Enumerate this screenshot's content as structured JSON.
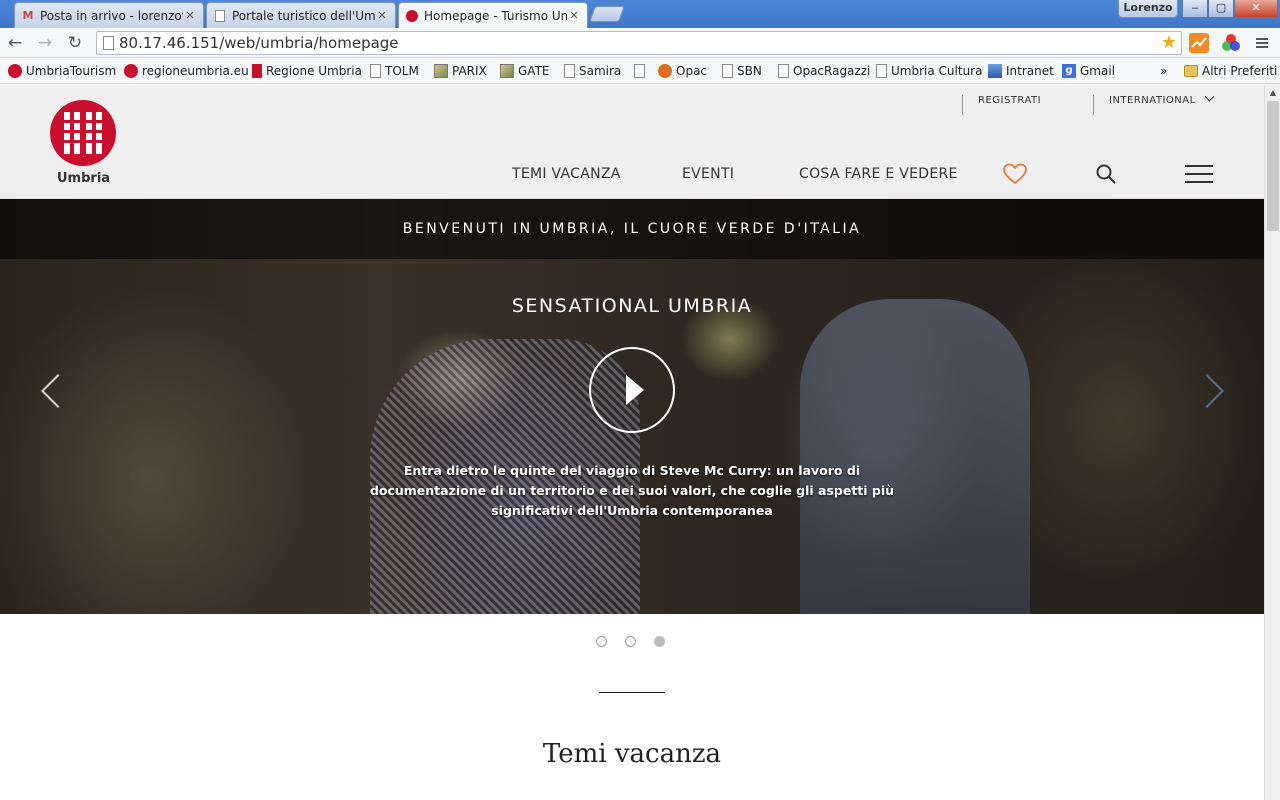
{
  "browser": {
    "tabs": [
      {
        "title": "Posta in arrivo - lorenzotra",
        "icon": "gmail-icon",
        "active": false
      },
      {
        "title": "Portale turistico dell'Umbr",
        "icon": "page-icon",
        "active": false
      },
      {
        "title": "Homepage - Turismo Um",
        "icon": "umbria-icon",
        "active": true
      }
    ],
    "close_glyph": "✕",
    "user": "Lorenzo",
    "window_buttons": {
      "minimize": "‒",
      "maximize": "▢",
      "close": "✕"
    },
    "nav": {
      "back": "←",
      "forward": "→",
      "reload": "↻"
    },
    "address": "80.17.46.151/web/umbria/homepage",
    "star": "★",
    "bookmarks": [
      {
        "label": "UmbriaTourism",
        "icon": "red"
      },
      {
        "label": "regioneumbria.eu",
        "icon": "red"
      },
      {
        "label": "Regione Umbria",
        "icon": "red"
      },
      {
        "label": "TOLM",
        "icon": "doc"
      },
      {
        "label": "PARIX",
        "icon": "img"
      },
      {
        "label": "GATE",
        "icon": "img"
      },
      {
        "label": "Samira",
        "icon": "doc"
      },
      {
        "label": "",
        "icon": "doc"
      },
      {
        "label": "Opac",
        "icon": "opac"
      },
      {
        "label": "SBN",
        "icon": "doc"
      },
      {
        "label": "OpacRagazzi",
        "icon": "doc"
      },
      {
        "label": "Umbria Cultura",
        "icon": "doc"
      },
      {
        "label": "Intranet",
        "icon": "intranet"
      },
      {
        "label": "Gmail",
        "icon": "g"
      }
    ],
    "more": "»",
    "other_bookmarks": "Altri Preferiti"
  },
  "header": {
    "logo_text": "Umbria",
    "top_links": {
      "register": "REGISTRATI",
      "international": "INTERNATIONAL"
    },
    "nav": {
      "themes": "TEMI VACANZA",
      "events": "EVENTI",
      "things": "COSA FARE E VEDERE"
    },
    "accent_color": "#e8773a"
  },
  "hero": {
    "banner": "BENVENUTI IN UMBRIA, IL CUORE VERDE D'ITALIA",
    "title": "SENSATIONAL UMBRIA",
    "description": "Entra dietro le quinte del viaggio di Steve Mc Curry: un lavoro di documentazione di un territorio e dei suoi valori, che coglie gli aspetti più significativi dell'Umbria contemporanea",
    "slides_total": 3,
    "active_slide": 3
  },
  "section": {
    "title": "Temi vacanza"
  }
}
